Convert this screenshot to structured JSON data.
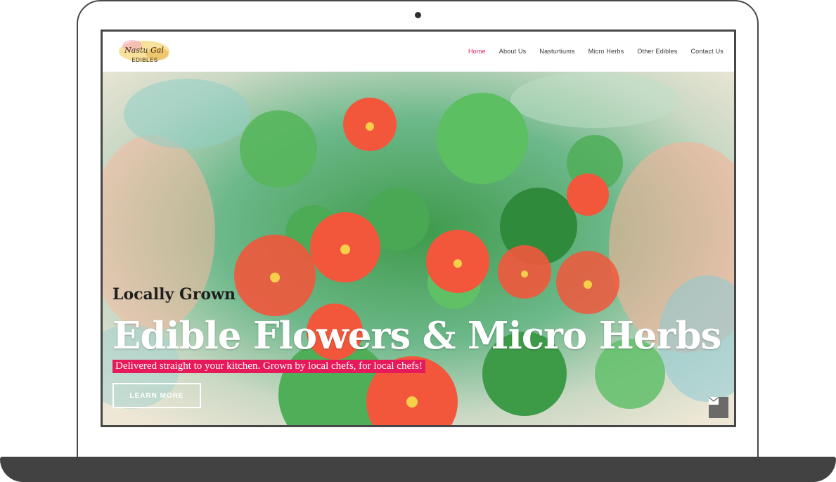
{
  "logo": {
    "line1": "Nastu Gal",
    "line2": "EDIBLES"
  },
  "nav": {
    "home": "Home",
    "about": "About Us",
    "nasturtiums": "Nasturtiums",
    "micro_herbs": "Micro Herbs",
    "other_edibles": "Other Edibles",
    "contact": "Contact Us"
  },
  "hero": {
    "eyebrow": "Locally Grown",
    "headline": "Edible Flowers & Micro Herbs",
    "tagline": "Delivered straight to your kitchen. Grown by local chefs, for local chefs!",
    "cta": "LEARN MORE"
  },
  "icons": {
    "contact_float": "envelope-icon"
  },
  "colors": {
    "accent": "#e6195a",
    "frame": "#474747",
    "flower": "#f2573c",
    "leaf": "#52b55a"
  }
}
